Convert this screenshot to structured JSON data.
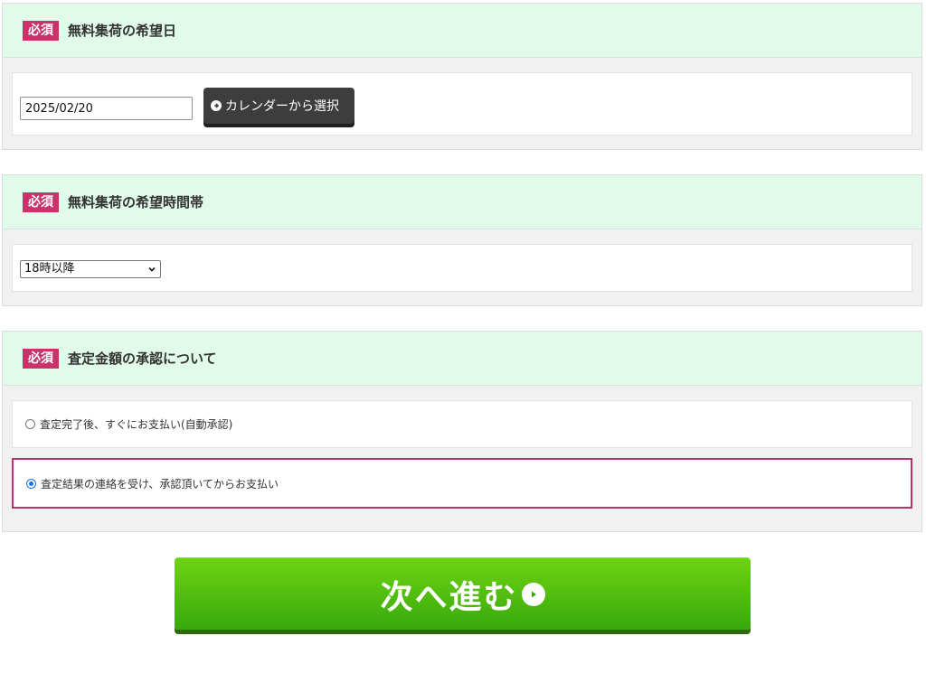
{
  "sections": [
    {
      "badge": "必須",
      "title": "無料集荷の希望日"
    },
    {
      "badge": "必須",
      "title": "無料集荷の希望時間帯"
    },
    {
      "badge": "必須",
      "title": "査定金額の承認について"
    }
  ],
  "pickup_date": {
    "value": "2025/02/20",
    "calendar_button": "カレンダーから選択"
  },
  "pickup_time": {
    "selected": "18時以降"
  },
  "approval": {
    "options": [
      {
        "label": "査定完了後、すぐにお支払い(自動承認)",
        "checked": false
      },
      {
        "label": "査定結果の連絡を受け、承認頂いてからお支払い",
        "checked": true
      }
    ]
  },
  "next_button": {
    "label": "次へ進む"
  },
  "colors": {
    "badge": "#c8336a",
    "header_bg": "#e1fbea",
    "next_green": "#4bbd0f",
    "selected_border": "#b8336a"
  }
}
